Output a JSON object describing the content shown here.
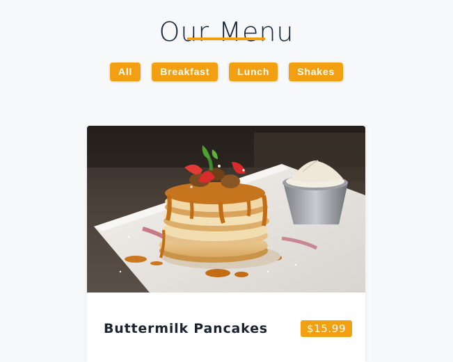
{
  "header": {
    "title": "Our Menu"
  },
  "filters": [
    {
      "label": "All"
    },
    {
      "label": "Breakfast"
    },
    {
      "label": "Lunch"
    },
    {
      "label": "Shakes"
    }
  ],
  "menu_items": [
    {
      "name": "Buttermilk Pancakes",
      "price": "$15.99",
      "image_subject": "pancake stack with caramel syrup and strawberries"
    }
  ],
  "colors": {
    "accent": "#f2a012",
    "title": "#13233a",
    "background": "#f7f8fa"
  }
}
